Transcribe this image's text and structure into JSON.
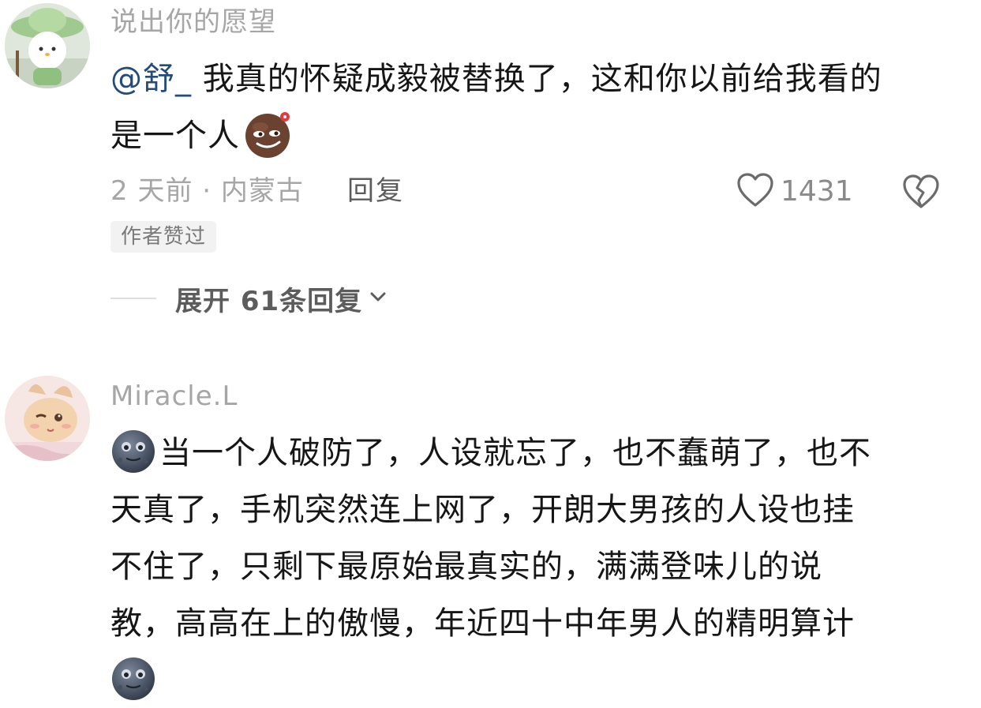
{
  "comments": [
    {
      "username": "说出你的愿望",
      "mention": "@舒_",
      "text_line1": " 我真的怀疑成毅被替换了，这和你以前给我看的",
      "text_line2": "是一个人",
      "meta": "2 天前 · 内蒙古",
      "reply_label": "回复",
      "like_count": "1431",
      "badge": "作者赞过",
      "expand_label": "展开 61条回复",
      "emoji": "smirk-emoji"
    },
    {
      "username": "Miracle.L",
      "lines": [
        "当一个人破防了，人设就忘了，也不蠢萌了，也不",
        "天真了，手机突然连上网了，开朗大男孩的人设也挂",
        "不住了，只剩下最原始最真实的，满满登味儿的说",
        "教，高高在上的傲慢，年近四十中年男人的精明算计"
      ],
      "emoji": "moon-face-emoji"
    }
  ]
}
